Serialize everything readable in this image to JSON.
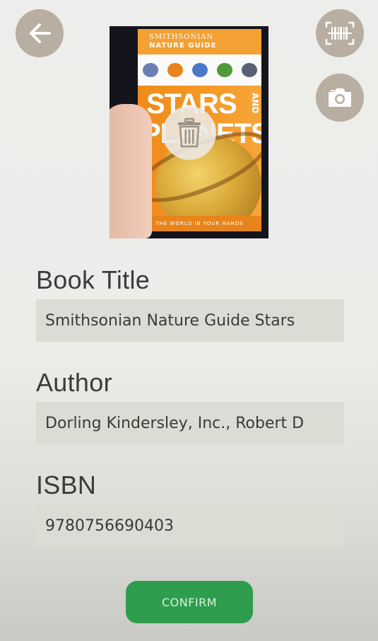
{
  "header": {
    "back_icon": "arrow-left-icon",
    "barcode_icon": "barcode-scan-icon",
    "camera_icon": "camera-icon"
  },
  "cover": {
    "delete_icon": "trash-icon",
    "book_brand": "SMITHSONIAN",
    "book_series": "NATURE GUIDE",
    "book_title_line1": "STARS",
    "book_title_line2": "PLANETS",
    "book_title_side": "AND",
    "book_tagline": "THE WORLD IN YOUR HANDS"
  },
  "form": {
    "title_label": "Book Title",
    "title_value": "Smithsonian Nature Guide Stars",
    "author_label": "Author",
    "author_value": "Dorling Kindersley, Inc., Robert D",
    "isbn_label": "ISBN",
    "isbn_value": "9780756690403"
  },
  "actions": {
    "confirm_label": "CONFIRM"
  },
  "colors": {
    "round_button": "#b8aea1",
    "confirm": "#2f9d4e",
    "input_bg": "#dcdcd4"
  }
}
